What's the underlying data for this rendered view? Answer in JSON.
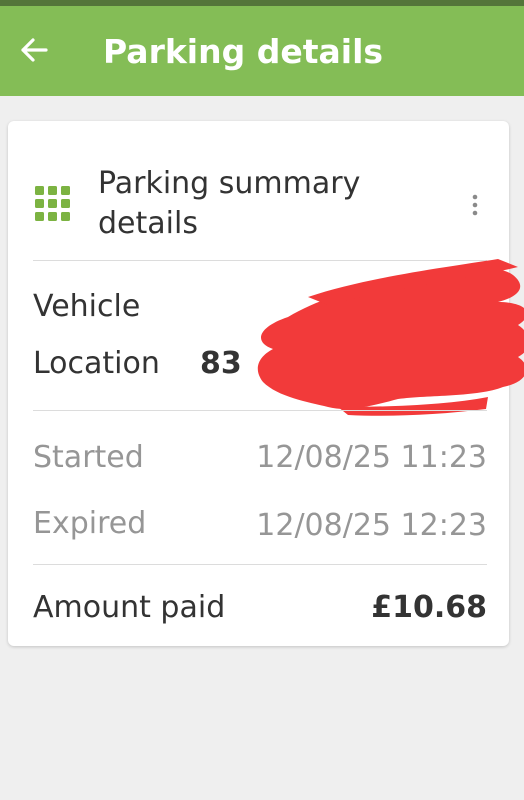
{
  "app_bar": {
    "title": "Parking details",
    "back_icon": "arrow-left-icon",
    "color": "#84bd56"
  },
  "card": {
    "title": "Parking summary details",
    "title_line1": "Parking summary",
    "title_line2": "details",
    "icon": "grid-icon",
    "menu_icon": "more-vert-icon",
    "icon_color": "#7cb342"
  },
  "vehicle": {
    "label": "Vehicle"
  },
  "location": {
    "label": "Location",
    "value_visible": "83"
  },
  "times": {
    "started_label": "Started",
    "started_value": "12/08/25 11:23",
    "expired_label": "Expired",
    "expired_value": "12/08/25 12:23"
  },
  "payment": {
    "label": "Amount paid",
    "value": "£10.68"
  },
  "redaction_color": "#f23a3a"
}
